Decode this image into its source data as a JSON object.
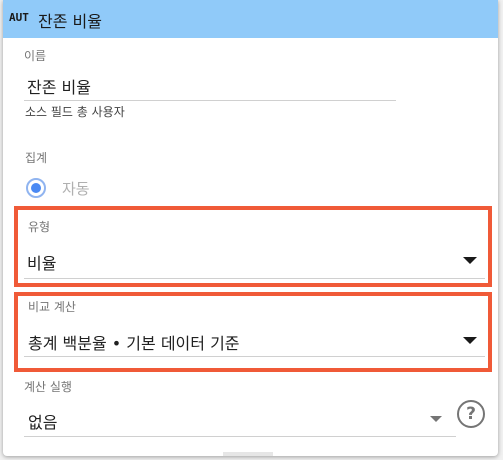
{
  "header": {
    "type_badge": "AUT",
    "title": "잔존 비율"
  },
  "name_field": {
    "label": "이름",
    "value": "잔존 비율",
    "char_count": ""
  },
  "source_field_description": "소스 필드 총 사용자",
  "aggregation": {
    "label": "집계",
    "option": "자동",
    "selected": true
  },
  "type_field": {
    "label": "유형",
    "value": "비율"
  },
  "comparison_calc": {
    "label": "비교 계산",
    "value": "총계 백분율 • 기본 데이터 기준"
  },
  "running_calc": {
    "label": "계산 실행",
    "value": "없음",
    "help_glyph": "?"
  },
  "colors": {
    "header": "#90caf9",
    "highlight": "#f05a38",
    "radio": "#4a89f3"
  },
  "icons": [
    "dropdown-arrow-icon",
    "help-circle-icon",
    "radio-selected-icon"
  ]
}
